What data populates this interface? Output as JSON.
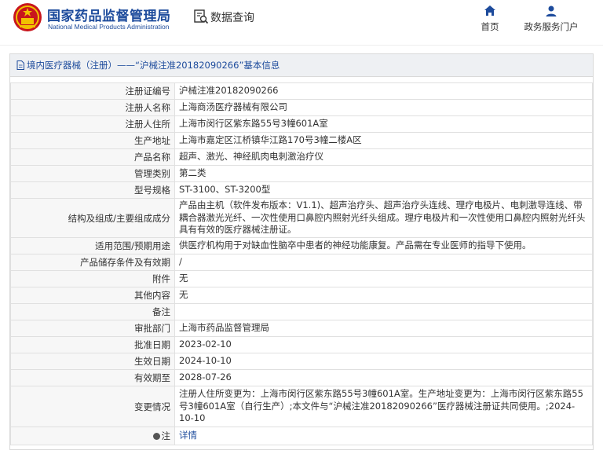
{
  "header": {
    "logo_cn": "国家药品监督管理局",
    "logo_en": "National Medical Products Administration",
    "query_label": "数据查询",
    "nav": [
      {
        "label": "首页",
        "icon": "home-icon"
      },
      {
        "label": "政务服务门户",
        "icon": "user-icon"
      }
    ]
  },
  "breadcrumb": "境内医疗器械（注册）——“沪械注准20182090266”基本信息",
  "rows": [
    {
      "label": "注册证编号",
      "value": "沪械注准20182090266"
    },
    {
      "label": "注册人名称",
      "value": "上海商汤医疗器械有限公司"
    },
    {
      "label": "注册人住所",
      "value": "上海市闵行区紫东路55号3幢601A室"
    },
    {
      "label": "生产地址",
      "value": "上海市嘉定区江桥镇华江路170号3幢二楼A区"
    },
    {
      "label": "产品名称",
      "value": "超声、激光、神经肌肉电刺激治疗仪"
    },
    {
      "label": "管理类别",
      "value": "第二类"
    },
    {
      "label": "型号规格",
      "value": "ST-3100、ST-3200型"
    },
    {
      "label": "结构及组成/主要组成成分",
      "value": "产品由主机（软件发布版本：V1.1)、超声治疗头、超声治疗头连线、理疗电极片、电刺激导连线、带耦合器激光光纤、一次性使用口鼻腔内照射光纤头组成。理疗电极片和一次性使用口鼻腔内照射光纤头具有有效的医疗器械注册证。"
    },
    {
      "label": "适用范围/预期用途",
      "value": "供医疗机构用于对缺血性脑卒中患者的神经功能康复。产品需在专业医师的指导下使用。"
    },
    {
      "label": "产品储存条件及有效期",
      "value": "/"
    },
    {
      "label": "附件",
      "value": "无"
    },
    {
      "label": "其他内容",
      "value": "无"
    },
    {
      "label": "备注",
      "value": ""
    },
    {
      "label": "审批部门",
      "value": "上海市药品监督管理局"
    },
    {
      "label": "批准日期",
      "value": "2023-02-10"
    },
    {
      "label": "生效日期",
      "value": "2024-10-10"
    },
    {
      "label": "有效期至",
      "value": "2028-07-26"
    },
    {
      "label": "变更情况",
      "value": "注册人住所变更为：上海市闵行区紫东路55号3幢601A室。生产地址变更为：上海市闵行区紫东路55号3幢601A室（自行生产）;本文件与“沪械注准20182090266”医疗器械注册证共同使用。;2024-10-10"
    }
  ],
  "note": {
    "label": "注",
    "value": "详情"
  }
}
